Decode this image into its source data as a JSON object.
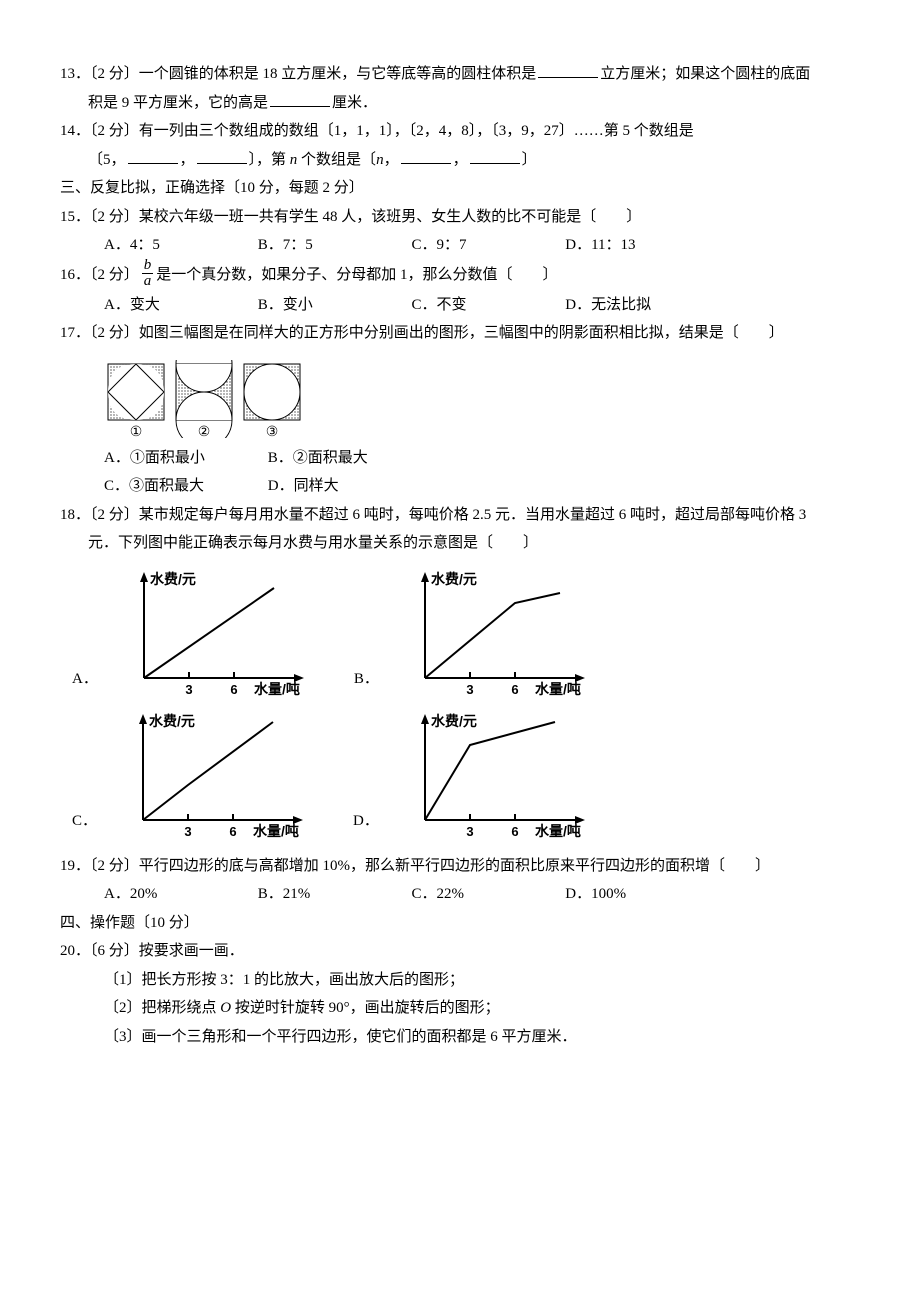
{
  "q13": {
    "label": "13．〔2 分〕一个圆锥的体积是 18 立方厘米，与它等底等高的圆柱体积是",
    "label2": "立方厘米；如果这个圆柱的底面",
    "line2a": "积是 9 平方厘米，它的高是",
    "line2b": "厘米．"
  },
  "q14": {
    "label": "14．〔2 分〕有一列由三个数组成的数组〔1，1，1〕，〔2，4，8〕，〔3，9，27〕……第 5 个数组是",
    "line2a": "〔5，",
    "line2b": "，",
    "line2c": "〕，第 ",
    "line2d": " 个数组是〔",
    "line2e": "，",
    "line2f": "，",
    "line2g": "〕",
    "nvar": "n",
    "nvar2": "n"
  },
  "section3": "三、反复比拟，正确选择〔10 分，每题 2 分〕",
  "q15": {
    "label": "15．〔2 分〕某校六年级一班一共有学生 48 人，该班男、女生人数的比不可能是〔　　〕",
    "optA": "A．4：5",
    "optB": "B．7：5",
    "optC": "C．9：7",
    "optD": "D．11：13"
  },
  "q16": {
    "pre": "16．〔2 分〕",
    "num": "b",
    "den": "a",
    "post": "是一个真分数，如果分子、分母都加 1，那么分数值〔　　〕",
    "optA": "A．变大",
    "optB": "B．变小",
    "optC": "C．不变",
    "optD": "D．无法比拟"
  },
  "q17": {
    "label": "17．〔2 分〕如图三幅图是在同样大的正方形中分别画出的图形，三幅图中的阴影面积相比拟，结果是〔　　〕",
    "optA": "A．①面积最小",
    "optB": "B．②面积最大",
    "optC": "C．③面积最大",
    "optD": "D．同样大",
    "c1": "①",
    "c2": "②",
    "c3": "③"
  },
  "q18": {
    "label": "18．〔2 分〕某市规定每户每月用水量不超过 6 吨时，每吨价格 2.5 元．当用水量超过 6 吨时，超过局部每吨价格 3",
    "line2": "元．下列图中能正确表示每月水费与用水量关系的示意图是〔　　〕",
    "ylabel": "水费/元",
    "xlabel": "水量/吨",
    "t3": "3",
    "t6": "6",
    "A": "A．",
    "B": "B．",
    "C": "C．",
    "D": "D．"
  },
  "q19": {
    "label": "19．〔2 分〕平行四边形的底与高都增加 10%，那么新平行四边形的面积比原来平行四边形的面积增〔　　〕",
    "optA": "A．20%",
    "optB": "B．21%",
    "optC": "C．22%",
    "optD": "D．100%"
  },
  "section4": "四、操作题〔10 分〕",
  "q20": {
    "label": "20．〔6 分〕按要求画一画．",
    "s1": "〔1〕把长方形按 3：1 的比放大，画出放大后的图形；",
    "s2pre": "〔2〕把梯形绕点 ",
    "s2o": "O",
    "s2post": " 按逆时针旋转 90°，画出旋转后的图形；",
    "s3": "〔3〕画一个三角形和一个平行四边形，使它们的面积都是 6 平方厘米．"
  },
  "chart_data": [
    {
      "type": "line",
      "series": "A",
      "x": [
        0,
        3,
        6,
        9
      ],
      "y": [
        0,
        7.5,
        15,
        24
      ],
      "break_x": null,
      "xlabel": "水量/吨",
      "ylabel": "水费/元"
    },
    {
      "type": "line",
      "series": "B",
      "x": [
        0,
        3,
        6,
        9
      ],
      "y": [
        0,
        7.5,
        15,
        19.5
      ],
      "break_x": 6,
      "slope_change": "down",
      "xlabel": "水量/吨",
      "ylabel": "水费/元"
    },
    {
      "type": "line",
      "series": "C",
      "x": [
        0,
        3,
        6,
        9
      ],
      "y": [
        0,
        7.5,
        15,
        24
      ],
      "break_x": 3,
      "slope_change": "up",
      "xlabel": "水量/吨",
      "ylabel": "水费/元"
    },
    {
      "type": "line",
      "series": "D",
      "x": [
        0,
        3,
        6,
        9
      ],
      "y": [
        0,
        9,
        15,
        24
      ],
      "break_x": 3,
      "slope_change": "down",
      "xlabel": "水量/吨",
      "ylabel": "水费/元"
    }
  ]
}
